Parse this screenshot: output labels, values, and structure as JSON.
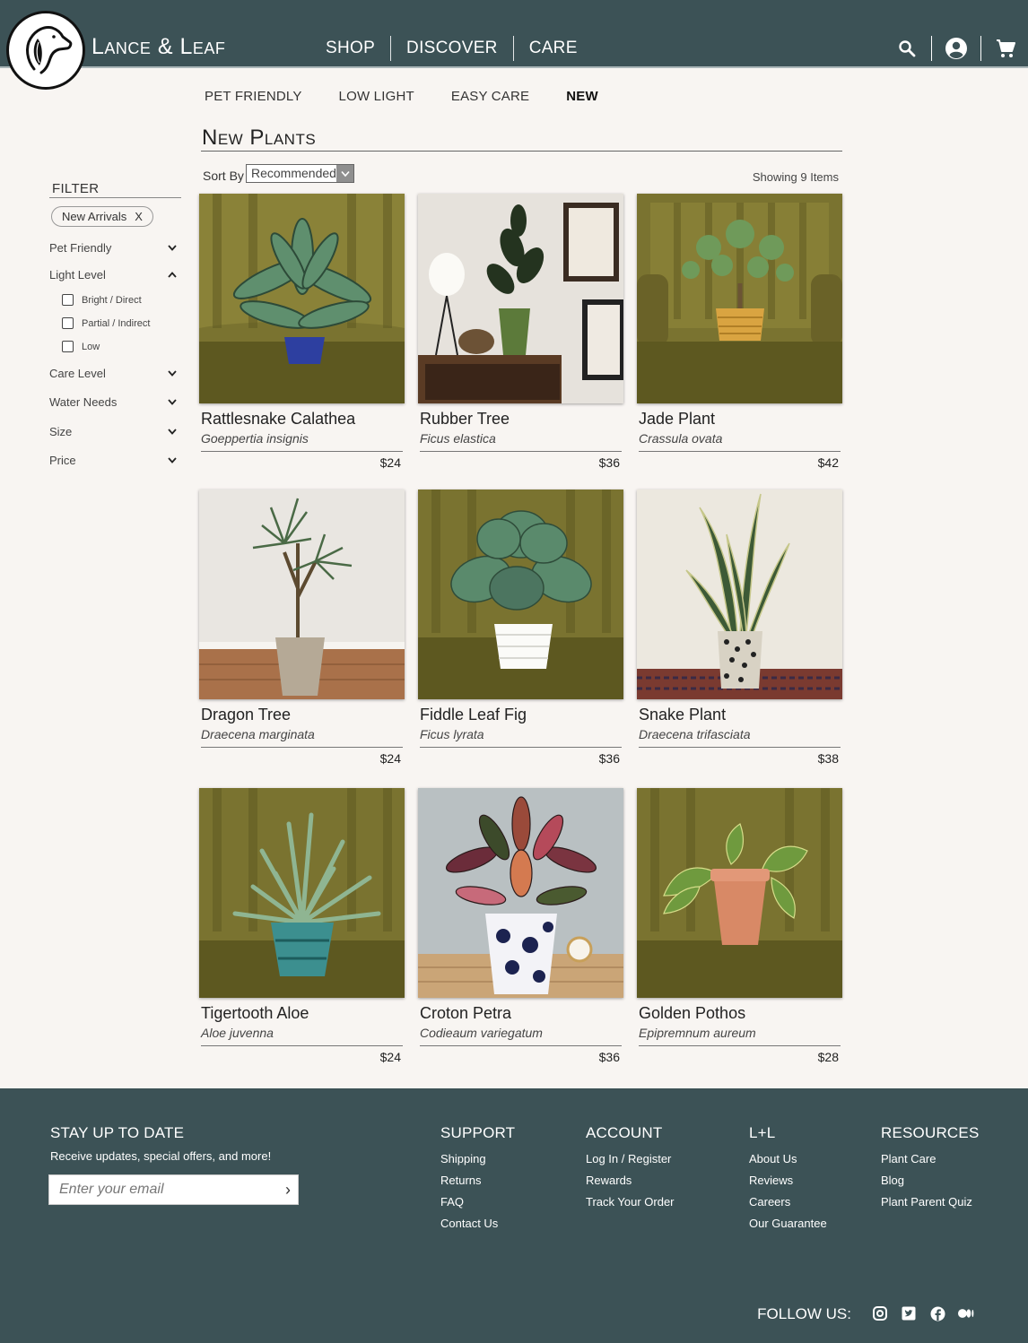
{
  "brand": {
    "name": "Lance & Leaf"
  },
  "main_nav": [
    "SHOP",
    "DISCOVER",
    "CARE"
  ],
  "sub_nav": [
    "PET FRIENDLY",
    "LOW LIGHT",
    "EASY CARE",
    "NEW"
  ],
  "page": {
    "title": "New Plants",
    "sort_label": "Sort By",
    "sort_value": "Recommended",
    "showing": "Showing 9 Items"
  },
  "filter": {
    "title": "FILTER",
    "chip_label": "New Arrivals",
    "chip_x": "X",
    "groups": [
      "Pet Friendly",
      "Light Level",
      "Care Level",
      "Water Needs",
      "Size",
      "Price"
    ],
    "light_options": [
      "Bright / Direct",
      "Partial / Indirect",
      "Low"
    ]
  },
  "products": [
    {
      "name": "Rattlesnake Calathea",
      "scientific": "Goeppertia insignis",
      "price": "$24"
    },
    {
      "name": "Rubber Tree",
      "scientific": "Ficus elastica",
      "price": "$36"
    },
    {
      "name": "Jade Plant",
      "scientific": "Crassula ovata",
      "price": "$42"
    },
    {
      "name": "Dragon Tree",
      "scientific": "Draecena marginata",
      "price": "$24"
    },
    {
      "name": "Fiddle Leaf Fig",
      "scientific": "Ficus lyrata",
      "price": "$36"
    },
    {
      "name": "Snake Plant",
      "scientific": "Draecena trifasciata",
      "price": "$38"
    },
    {
      "name": "Tigertooth Aloe",
      "scientific": "Aloe juvenna",
      "price": "$24"
    },
    {
      "name": "Croton Petra",
      "scientific": "Codieaum variegatum",
      "price": "$36"
    },
    {
      "name": "Golden Pothos",
      "scientific": "Epipremnum aureum",
      "price": "$28"
    }
  ],
  "footer": {
    "stay_title": "STAY UP TO DATE",
    "stay_sub": "Receive updates, special offers, and more!",
    "email_placeholder": "Enter your email",
    "submit_arrow": "›",
    "support": {
      "title": "SUPPORT",
      "links": [
        "Shipping",
        "Returns",
        "FAQ",
        "Contact Us"
      ]
    },
    "account": {
      "title": "ACCOUNT",
      "links": [
        "Log In / Register",
        "Rewards",
        "Track Your Order"
      ]
    },
    "ll": {
      "title": "L+L",
      "links": [
        "About Us",
        "Reviews",
        "Careers",
        "Our Guarantee"
      ]
    },
    "resources": {
      "title": "RESOURCES",
      "links": [
        "Plant Care",
        "Blog",
        "Plant Parent Quiz"
      ]
    },
    "follow": "FOLLOW US:",
    "socials": [
      "instagram-icon",
      "twitter-icon",
      "facebook-icon",
      "medium-icon"
    ]
  },
  "colors": {
    "header": "#3c5256",
    "background": "#f8f5f2",
    "velvet": "#6e6a26"
  }
}
